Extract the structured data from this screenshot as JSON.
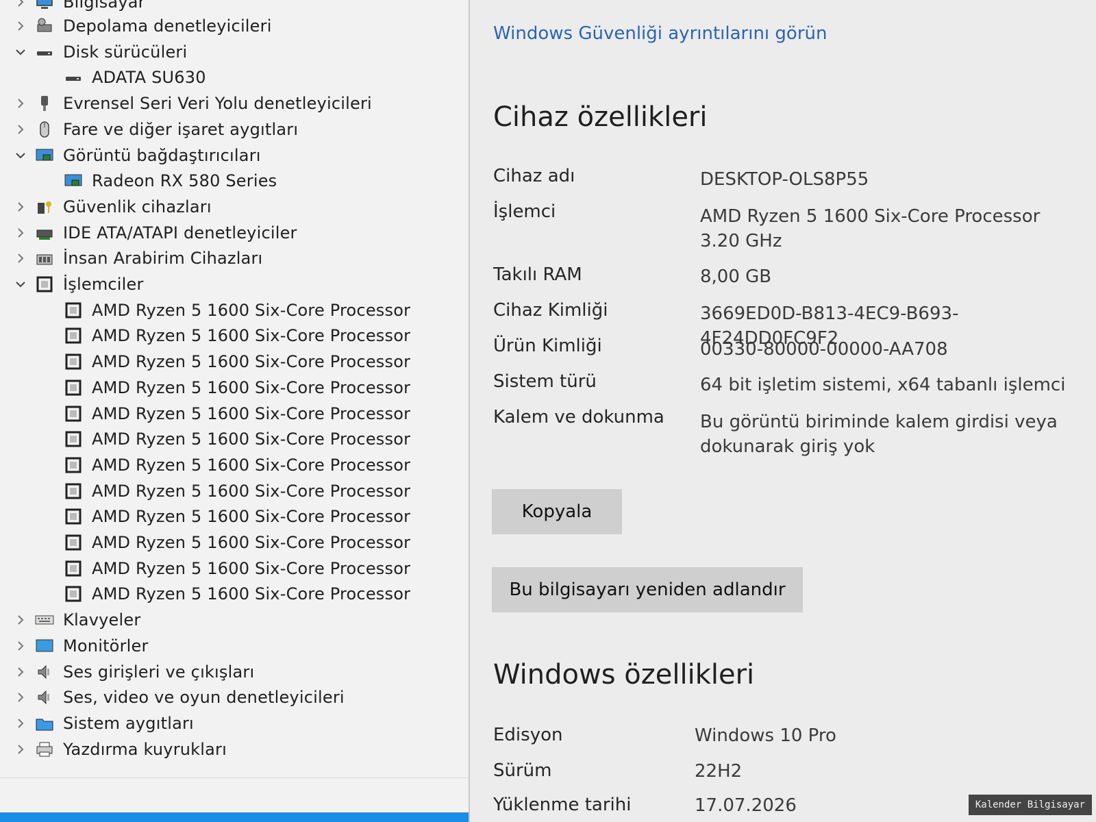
{
  "left": {
    "top_item": "Bilgisayar",
    "categories": [
      {
        "label": "Depolama denetleyicileri",
        "expanded": false,
        "icon": "storage-controller-icon"
      },
      {
        "label": "Disk sürücüleri",
        "expanded": true,
        "icon": "disk-drive-icon"
      },
      {
        "label": "Evrensel Seri Veri Yolu denetleyicileri",
        "expanded": false,
        "icon": "usb-icon"
      },
      {
        "label": "Fare ve diğer işaret aygıtları",
        "expanded": false,
        "icon": "mouse-icon"
      },
      {
        "label": "Görüntü bağdaştırıcıları",
        "expanded": true,
        "icon": "display-adapter-icon"
      },
      {
        "label": "Güvenlik cihazları",
        "expanded": false,
        "icon": "security-device-icon"
      },
      {
        "label": "IDE ATA/ATAPI denetleyiciler",
        "expanded": false,
        "icon": "ide-controller-icon"
      },
      {
        "label": "İnsan Arabirim Cihazları",
        "expanded": false,
        "icon": "hid-icon"
      },
      {
        "label": "İşlemciler",
        "expanded": true,
        "icon": "processor-icon"
      },
      {
        "label": "Klavyeler",
        "expanded": false,
        "icon": "keyboard-icon"
      },
      {
        "label": "Monitörler",
        "expanded": false,
        "icon": "monitor-icon"
      },
      {
        "label": "Ses girişleri ve çıkışları",
        "expanded": false,
        "icon": "speaker-icon"
      },
      {
        "label": "Ses, video ve oyun denetleyicileri",
        "expanded": false,
        "icon": "speaker-icon"
      },
      {
        "label": "Sistem aygıtları",
        "expanded": false,
        "icon": "system-folder-icon"
      },
      {
        "label": "Yazdırma kuyrukları",
        "expanded": false,
        "icon": "printer-icon"
      }
    ],
    "disk_child": "ADATA SU630",
    "display_child": "Radeon RX 580 Series",
    "processor_child": "AMD Ryzen 5 1600 Six-Core Processor"
  },
  "right": {
    "security_link": "Windows Güvenliği ayrıntılarını görün",
    "device_specs_title": "Cihaz özellikleri",
    "device_specs": [
      {
        "label": "Cihaz adı",
        "value": "DESKTOP-OLS8P55"
      },
      {
        "label": "İşlemci",
        "value": "AMD Ryzen 5 1600 Six-Core Processor",
        "value2": "3.20 GHz"
      },
      {
        "label": "Takılı RAM",
        "value": "8,00 GB"
      },
      {
        "label": "Cihaz Kimliği",
        "value": "3669ED0D-B813-4EC9-B693-4F24DD0FC9F2"
      },
      {
        "label": "Ürün Kimliği",
        "value": "00330-80000-00000-AA708"
      },
      {
        "label": "Sistem türü",
        "value": "64 bit işletim sistemi, x64 tabanlı işlemci"
      },
      {
        "label": "Kalem ve dokunma",
        "value": "Bu görüntü biriminde kalem girdisi veya",
        "value2": "dokunarak giriş yok"
      }
    ],
    "copy_button": "Kopyala",
    "rename_button": "Bu bilgisayarı yeniden adlandır",
    "windows_specs_title": "Windows özellikleri",
    "windows_specs": [
      {
        "label": "Edisyon",
        "value": "Windows 10 Pro"
      },
      {
        "label": "Sürüm",
        "value": "22H2"
      },
      {
        "label": "Yüklenme tarihi",
        "value": "17.07.2026"
      }
    ]
  },
  "watermark": "Kalender Bilgisayar",
  "colors": {
    "link": "#2a64b4",
    "status_strip": "#1a8ee6",
    "button": "#cfcfcf"
  }
}
